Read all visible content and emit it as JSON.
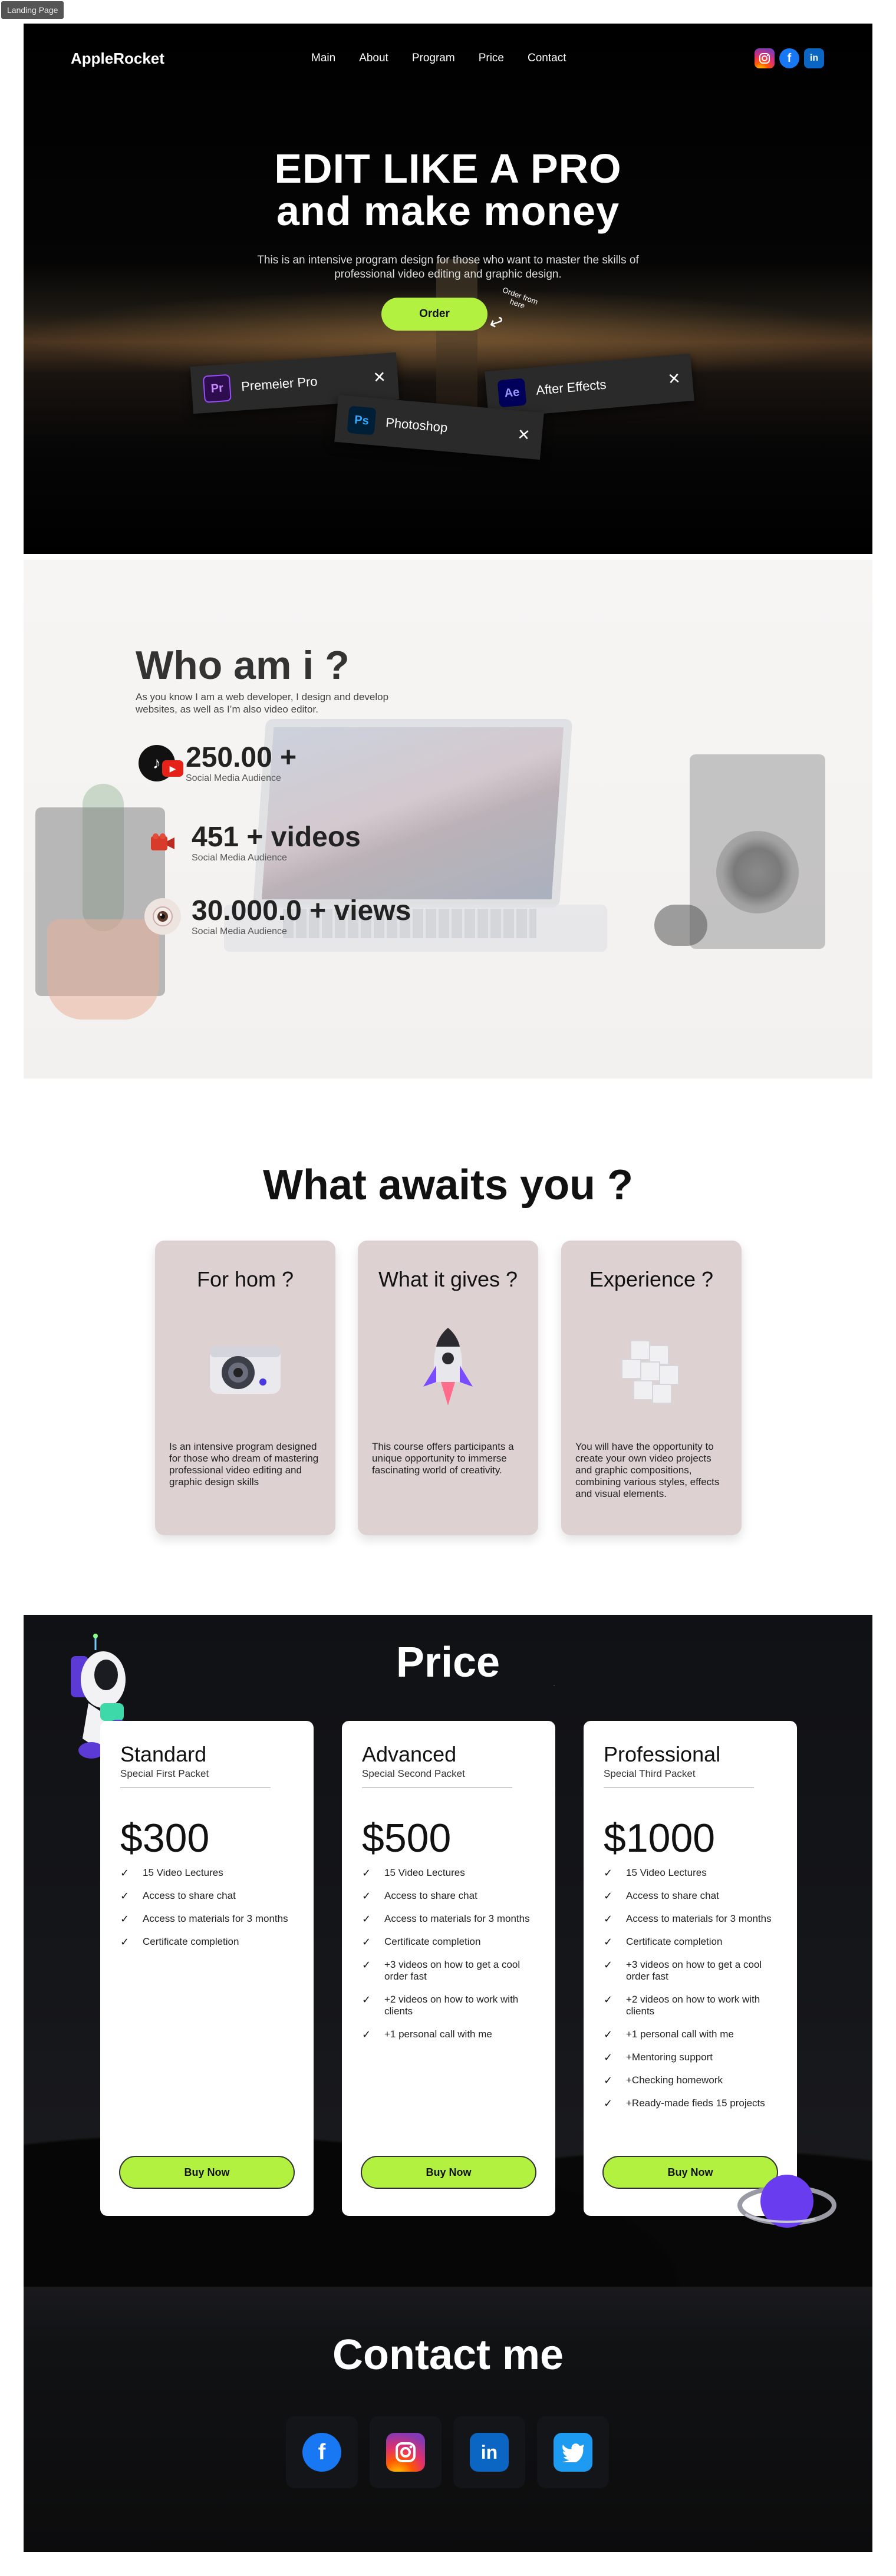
{
  "frame_label": "Landing Page",
  "header": {
    "logo": "AppleRocket",
    "nav": [
      "Main",
      "About",
      "Program",
      "Price",
      "Contact"
    ],
    "social_icons": [
      "instagram-icon",
      "facebook-icon",
      "linkedin-icon"
    ]
  },
  "hero": {
    "title_line1": "EDIT LIKE A PRO",
    "title_line2": "and make money",
    "subtitle": "This is an intensive program design for those who want to master the skills of professional video editing  and graphic design.",
    "order_button": "Order",
    "order_note": "Order from here",
    "chips": [
      {
        "badge": "Pr",
        "label": "Premeier Pro"
      },
      {
        "badge": "Ps",
        "label": "Photoshop"
      },
      {
        "badge": "Ae",
        "label": "After Effects"
      }
    ],
    "close_glyph": "✕"
  },
  "about": {
    "title": "Who am i ?",
    "text": "As you know I am a web developer,  I  design and develop websites, as well as I’m also video editor.",
    "stats": [
      {
        "value": "250.00 +",
        "label": "Social Media Audience",
        "icon": "tiktok-icon"
      },
      {
        "value": "451 + videos",
        "label": "Social Media Audience",
        "icon": "video-camera-icon"
      },
      {
        "value": "30.000.0 + views",
        "label": "Social Media Audience",
        "icon": "eye-icon"
      }
    ]
  },
  "awaits": {
    "title": "What awaits you ?",
    "cards": [
      {
        "title": "For hom ?",
        "text": " Is an intensive program  designed for those who dream of mastering professional video  editing and graphic design skills",
        "icon": "camera-icon"
      },
      {
        "title": "What it gives ?",
        "text": "This course offers participants a unique opportunity to immerse fascinating world of creativity.",
        "icon": "rocket-icon"
      },
      {
        "title": "Experience ?",
        "text": "You will have the opportunity to create your own video projects and graphic compositions, combining various styles, effects and visual elements.",
        "icon": "cubes-icon"
      }
    ]
  },
  "pricing": {
    "title": "Price",
    "check_glyph": "✓",
    "plans": [
      {
        "name": "Standard",
        "tagline": "Special First Packet",
        "price": "$300",
        "features": [
          "15 Video Lectures",
          "Access to share chat",
          "Access to materials for 3 months",
          "Certificate completion"
        ],
        "button": "Buy Now"
      },
      {
        "name": "Advanced",
        "tagline": "Special Second Packet",
        "price": "$500",
        "features": [
          "15 Video Lectures",
          "Access to share chat",
          "Access to materials for 3 months",
          "Certificate completion",
          "+3 videos on how to get a cool order fast",
          "+2 videos on how to work with clients",
          "+1 personal call with me"
        ],
        "button": "Buy Now"
      },
      {
        "name": "Professional",
        "tagline": "Special Third Packet",
        "price": "$1000",
        "features": [
          "15 Video Lectures",
          "Access to share chat",
          "Access to materials for 3 months",
          "Certificate completion",
          "+3 videos on how to get a cool order fast",
          "+2 videos on how to work with clients",
          "+1 personal call with me",
          "+Mentoring support",
          "+Checking homework",
          "+Ready-made fieds 15 projects"
        ],
        "button": "Buy Now"
      }
    ]
  },
  "contact": {
    "title": "Contact me",
    "icons": [
      "facebook-icon",
      "instagram-icon",
      "linkedin-icon",
      "twitter-icon"
    ]
  },
  "colors": {
    "accent": "#b2f13f",
    "hero_bg": "#000000",
    "card_bg": "#ddd2d1",
    "dark_bg": "#15161a"
  }
}
